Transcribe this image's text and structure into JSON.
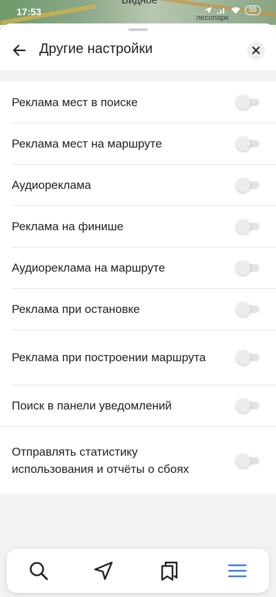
{
  "status_bar": {
    "time": "17:53",
    "battery": "55",
    "map_label_top": "Видное",
    "map_label_right": "лесопарк"
  },
  "header": {
    "title": "Другие настройки"
  },
  "settings_group1": [
    {
      "label": "Реклама мест в поиске",
      "enabled": false
    },
    {
      "label": "Реклама мест на маршруте",
      "enabled": false
    },
    {
      "label": "Аудиореклама",
      "enabled": false
    },
    {
      "label": "Реклама на финише",
      "enabled": false
    },
    {
      "label": "Аудиореклама на маршруте",
      "enabled": false
    },
    {
      "label": "Реклама при остановке",
      "enabled": false
    },
    {
      "label": "Реклама при построении маршрута",
      "enabled": false
    },
    {
      "label": "Поиск в панели уведомлений",
      "enabled": false
    }
  ],
  "settings_group2": [
    {
      "label": "Отправлять статистику использования и отчёты о сбоях",
      "enabled": false
    }
  ],
  "bottom_nav": {
    "items": [
      "search-icon",
      "navigation-arrow-icon",
      "bookmarks-icon",
      "menu-icon"
    ],
    "active": "menu-icon",
    "accent_color": "#3d7be0"
  }
}
